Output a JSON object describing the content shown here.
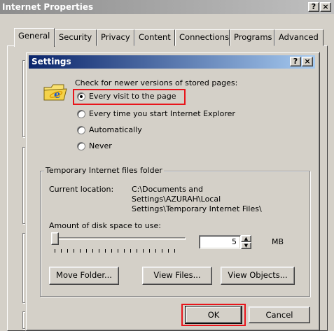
{
  "outer": {
    "title": "Internet Properties",
    "help_label": "?",
    "close_label": "×",
    "tabs": [
      "General",
      "Security",
      "Privacy",
      "Content",
      "Connections",
      "Programs",
      "Advanced"
    ]
  },
  "settings": {
    "title": "Settings",
    "help_label": "?",
    "close_label": "×",
    "check_label": "Check for newer versions of stored pages:",
    "options": [
      {
        "label": "Every visit to the page",
        "selected": true
      },
      {
        "label": "Every time you start Internet Explorer",
        "selected": false
      },
      {
        "label": "Automatically",
        "selected": false
      },
      {
        "label": "Never",
        "selected": false
      }
    ],
    "temp_group_label": "Temporary Internet files folder",
    "current_location_label": "Current location:",
    "current_location_lines": [
      "C:\\Documents and",
      "Settings\\AZURAH\\Local",
      "Settings\\Temporary Internet Files\\"
    ],
    "disk_space_label": "Amount of disk space to use:",
    "disk_space_value": "5",
    "disk_space_unit": "MB",
    "slider_level": 0,
    "move_folder_label": "Move Folder...",
    "view_files_label": "View Files...",
    "view_objects_label": "View Objects...",
    "ok_label": "OK",
    "cancel_label": "Cancel"
  },
  "colors": {
    "highlight": "#e8151b",
    "active_title": "#0a246a",
    "inactive_title": "#8d8d8d"
  }
}
